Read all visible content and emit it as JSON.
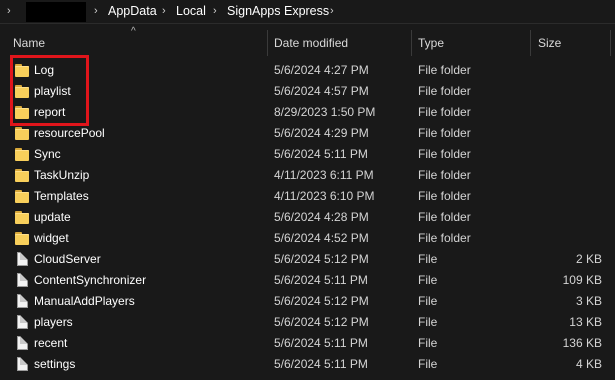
{
  "breadcrumb": [
    "AppData",
    "Local",
    "SignApps Express"
  ],
  "columns": {
    "name": "Name",
    "date_modified": "Date modified",
    "type": "Type",
    "size": "Size"
  },
  "files": [
    {
      "name": "Log",
      "date": "5/6/2024 4:27 PM",
      "type": "File folder",
      "size": "",
      "kind": "folder"
    },
    {
      "name": "playlist",
      "date": "5/6/2024 4:57 PM",
      "type": "File folder",
      "size": "",
      "kind": "folder"
    },
    {
      "name": "report",
      "date": "8/29/2023 1:50 PM",
      "type": "File folder",
      "size": "",
      "kind": "folder"
    },
    {
      "name": "resourcePool",
      "date": "5/6/2024 4:29 PM",
      "type": "File folder",
      "size": "",
      "kind": "folder"
    },
    {
      "name": "Sync",
      "date": "5/6/2024 5:11 PM",
      "type": "File folder",
      "size": "",
      "kind": "folder"
    },
    {
      "name": "TaskUnzip",
      "date": "4/11/2023 6:11 PM",
      "type": "File folder",
      "size": "",
      "kind": "folder"
    },
    {
      "name": "Templates",
      "date": "4/11/2023 6:10 PM",
      "type": "File folder",
      "size": "",
      "kind": "folder"
    },
    {
      "name": "update",
      "date": "5/6/2024 4:28 PM",
      "type": "File folder",
      "size": "",
      "kind": "folder"
    },
    {
      "name": "widget",
      "date": "5/6/2024 4:52 PM",
      "type": "File folder",
      "size": "",
      "kind": "folder"
    },
    {
      "name": "CloudServer",
      "date": "5/6/2024 5:12 PM",
      "type": "File",
      "size": "2 KB",
      "kind": "file"
    },
    {
      "name": "ContentSynchronizer",
      "date": "5/6/2024 5:11 PM",
      "type": "File",
      "size": "109 KB",
      "kind": "file"
    },
    {
      "name": "ManualAddPlayers",
      "date": "5/6/2024 5:12 PM",
      "type": "File",
      "size": "3 KB",
      "kind": "file"
    },
    {
      "name": "players",
      "date": "5/6/2024 5:12 PM",
      "type": "File",
      "size": "13 KB",
      "kind": "file"
    },
    {
      "name": "recent",
      "date": "5/6/2024 5:11 PM",
      "type": "File",
      "size": "136 KB",
      "kind": "file"
    },
    {
      "name": "settings",
      "date": "5/6/2024 5:11 PM",
      "type": "File",
      "size": "4 KB",
      "kind": "file"
    }
  ],
  "colors": {
    "background": "#191919",
    "highlight_box": "#e0151b",
    "folder": "#f8cf5b"
  }
}
